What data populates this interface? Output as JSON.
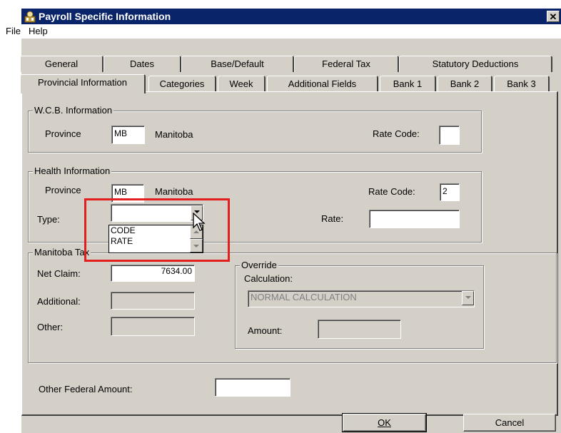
{
  "window": {
    "title": "Payroll Specific Information",
    "close_glyph": "✕"
  },
  "menu": [
    "File",
    "Help"
  ],
  "tabs_back": [
    "General",
    "Dates",
    "Base/Default",
    "Federal Tax",
    "Statutory Deductions"
  ],
  "tabs_front": [
    "Provincial Information",
    "Categories",
    "Week",
    "Additional Fields",
    "Bank 1",
    "Bank 2",
    "Bank 3"
  ],
  "wcb": {
    "legend": "W.C.B. Information",
    "province_label": "Province",
    "province_code": "MB",
    "province_name": "Manitoba",
    "rate_code_label": "Rate Code:",
    "rate_code": ""
  },
  "health": {
    "legend": "Health Information",
    "province_label": "Province",
    "province_code": "MB",
    "province_name": "Manitoba",
    "rate_code_label": "Rate Code:",
    "rate_code": "2",
    "type_label": "Type:",
    "type_value": "",
    "type_options": [
      "CODE",
      "RATE"
    ],
    "rate_label": "Rate:",
    "rate": ""
  },
  "manitoba_tax": {
    "legend": "Manitoba Tax",
    "net_claim_label": "Net Claim:",
    "net_claim": "7634.00",
    "additional_label": "Additional:",
    "additional": "",
    "other_label": "Other:",
    "other": ""
  },
  "override": {
    "legend": "Override",
    "calculation_label": "Calculation:",
    "calculation_value": "NORMAL CALCULATION",
    "amount_label": "Amount:",
    "amount": ""
  },
  "other_federal": {
    "label": "Other Federal Amount:",
    "value": ""
  },
  "buttons": {
    "ok": "OK",
    "cancel": "Cancel"
  },
  "icons": {
    "app": "payroll-app-icon",
    "cursor": "mouse-pointer-icon"
  },
  "colors": {
    "titlebar": "#0a246a",
    "highlight": "#e31e1e",
    "face": "#d4d0c8"
  }
}
